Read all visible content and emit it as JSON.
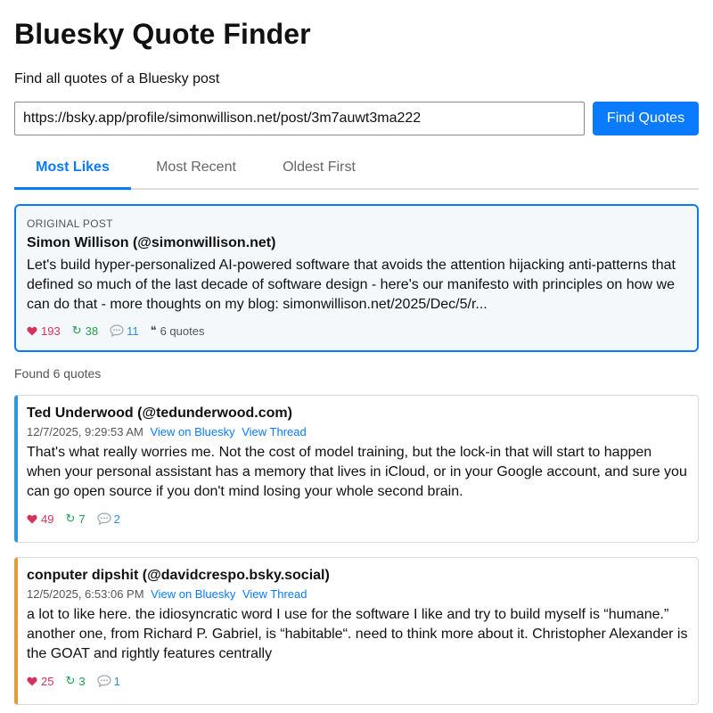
{
  "header": {
    "title": "Bluesky Quote Finder",
    "subtitle": "Find all quotes of a Bluesky post"
  },
  "search": {
    "url_value": "https://bsky.app/profile/simonwillison.net/post/3m7auwt3ma222",
    "button_label": "Find Quotes"
  },
  "tabs": [
    {
      "label": "Most Likes",
      "active": true
    },
    {
      "label": "Most Recent",
      "active": false
    },
    {
      "label": "Oldest First",
      "active": false
    }
  ],
  "original_post": {
    "section_label": "ORIGINAL POST",
    "author": "Simon Willison (@simonwillison.net)",
    "text": "Let's build hyper-personalized AI-powered software that avoids the attention hijacking anti-patterns that defined so much of the last decade of software design - here's our manifesto with principles on how we can do that - more thoughts on my blog: simonwillison.net/2025/Dec/5/r...",
    "likes": "193",
    "reposts": "38",
    "replies": "11",
    "quotes": "6 quotes"
  },
  "results": {
    "found_text": "Found 6 quotes"
  },
  "quotes": [
    {
      "author": "Ted Underwood (@tedunderwood.com)",
      "timestamp": "12/7/2025, 9:29:53 AM",
      "view_link": "View on Bluesky",
      "thread_link": "View Thread",
      "text": "That's what really worries me. Not the cost of model training, but the lock-in that will start to happen when your personal assistant has a memory that lives in iCloud, or in your Google account, and sure you can go open source if you don't mind losing your whole second brain.",
      "likes": "49",
      "reposts": "7",
      "replies": "2",
      "accent": "#2f98d8"
    },
    {
      "author": "conputer dipshit (@davidcrespo.bsky.social)",
      "timestamp": "12/5/2025, 6:53:06 PM",
      "view_link": "View on Bluesky",
      "thread_link": "View Thread",
      "text": "a lot to like here. the idiosyncratic word I use for the software I like and try to build myself is “humane.” another one, from Richard P. Gabriel, is “habitable“. need to think more about it. Christopher Alexander is the GOAT and rightly features centrally",
      "likes": "25",
      "reposts": "3",
      "replies": "1",
      "accent": "#e39a3a"
    }
  ],
  "colors": {
    "accent": "#0a7bff",
    "like": "#d6335c",
    "repost": "#18a34a",
    "reply": "#2a8be0"
  }
}
